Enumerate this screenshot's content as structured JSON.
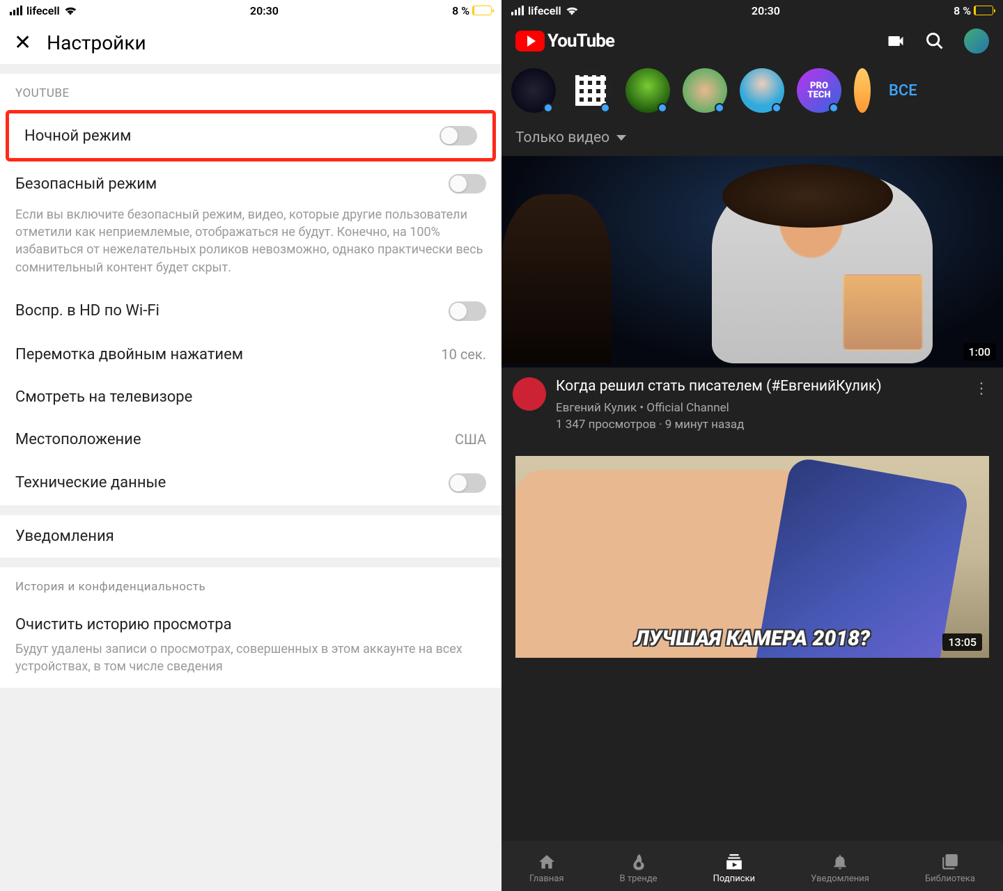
{
  "status": {
    "carrier": "lifecell",
    "time": "20:30",
    "battery": "8 %"
  },
  "left": {
    "title": "Настройки",
    "section_header": "YOUTUBE",
    "night_mode": "Ночной режим",
    "safe_mode": "Безопасный режим",
    "safe_desc": "Если вы включите безопасный режим, видео, которые другие пользователи отметили как неприемлемые, отображаться не будут. Конечно, на 100% избавиться от нежелательных роликов невозможно, однако практически весь сомнительный контент будет скрыт.",
    "hd_wifi": "Воспр. в HD по Wi-Fi",
    "double_tap": "Перемотка двойным нажатием",
    "double_tap_val": "10 сек.",
    "watch_tv": "Смотреть на телевизоре",
    "location": "Местоположение",
    "location_val": "США",
    "tech": "Технические данные",
    "notifications": "Уведомления",
    "history_header": "История и конфиденциальность",
    "clear_history": "Очистить историю просмотра",
    "clear_desc": "Будут удалены записи о просмотрах, совершенных в этом аккаунте на всех устройствах, в том числе сведения"
  },
  "right": {
    "logo": "YouTube",
    "all": "ВСЕ",
    "ch6a": "PRO",
    "ch6b": "TECH",
    "filter": "Только видео",
    "video1": {
      "title": "Когда решил стать писателем (#ЕвгенийКулик)",
      "channel": "Евгений Кулик • Official Channel",
      "stats": "1 347 просмотров · 9 минут назад",
      "duration": "1:00"
    },
    "video2": {
      "title": "ЛУЧШАЯ КАМЕРА 2018?",
      "duration": "13:05"
    },
    "nav": {
      "home": "Главная",
      "trending": "В тренде",
      "subs": "Подписки",
      "notif": "Уведомления",
      "library": "Библиотека"
    }
  }
}
